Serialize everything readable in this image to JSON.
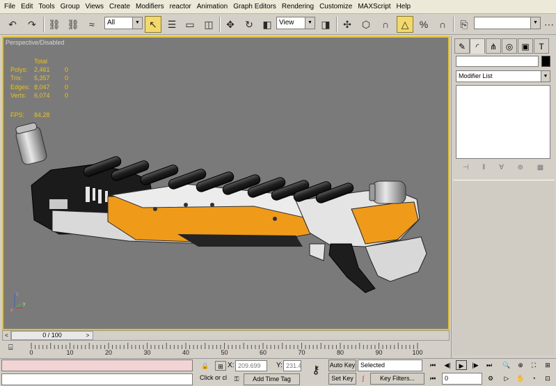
{
  "menu": [
    "File",
    "Edit",
    "Tools",
    "Group",
    "Views",
    "Create",
    "Modifiers",
    "reactor",
    "Animation",
    "Graph Editors",
    "Rendering",
    "Customize",
    "MAXScript",
    "Help"
  ],
  "toolbar": {
    "selection_filter": "All",
    "ref_coord": "View",
    "named_selection": ""
  },
  "viewport": {
    "label": "Perspective/Disabled",
    "stats_header": "Total",
    "stats": [
      {
        "label": "Polys:",
        "total": "2,461",
        "sel": "0"
      },
      {
        "label": "Tris:",
        "total": "5,357",
        "sel": "0"
      },
      {
        "label": "Edges:",
        "total": "8,047",
        "sel": "0"
      },
      {
        "label": "Verts:",
        "total": "6,074",
        "sel": "0"
      }
    ],
    "fps_label": "FPS:",
    "fps_value": "84.28",
    "axis": {
      "z": "z",
      "y": "y",
      "x": "x"
    }
  },
  "time": {
    "slider": "0 / 100",
    "left": "<",
    "right": ">",
    "ticks": [
      "0",
      "10",
      "20",
      "30",
      "40",
      "50",
      "60",
      "70",
      "80",
      "90",
      "100"
    ]
  },
  "status": {
    "prompt": "Click or cl",
    "add_time_tag": "Add Time Tag",
    "x_label": "X:",
    "x_value": "209.699",
    "y_label": "Y:",
    "y_value": "231.45",
    "auto_key": "Auto Key",
    "set_key": "Set Key",
    "key_mode": "Selected",
    "key_filters": "Key Filters...",
    "frame": "0"
  },
  "command_panel": {
    "modifier_list": "Modifier List"
  },
  "colors": {
    "viewport_bg": "#7a7a7a",
    "active_border": "#e8c31b",
    "stats_text": "#e8c31b",
    "gun_orange": "#f09a1a"
  }
}
